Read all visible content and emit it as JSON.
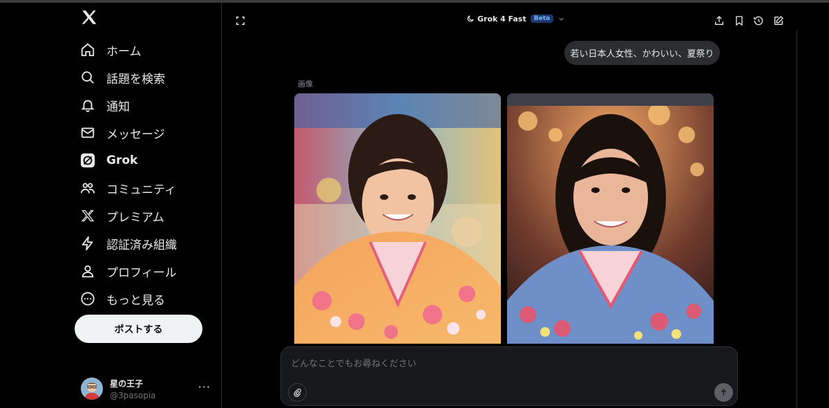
{
  "sidebar": {
    "logo_icon": "x-logo-icon",
    "items": [
      {
        "label": "ホーム",
        "icon": "home-icon"
      },
      {
        "label": "話題を検索",
        "icon": "search-icon"
      },
      {
        "label": "通知",
        "icon": "bell-icon"
      },
      {
        "label": "メッセージ",
        "icon": "mail-icon"
      },
      {
        "label": "Grok",
        "icon": "grok-icon",
        "active": true
      },
      {
        "label": "コミュニティ",
        "icon": "community-icon"
      },
      {
        "label": "プレミアム",
        "icon": "x-premium-icon"
      },
      {
        "label": "認証済み組織",
        "icon": "lightning-icon"
      },
      {
        "label": "プロフィール",
        "icon": "person-icon"
      },
      {
        "label": "もっと見る",
        "icon": "more-circle-icon"
      }
    ],
    "post_button": "ポストする",
    "account": {
      "name": "星の王子",
      "handle": "@3pasopia"
    }
  },
  "header": {
    "model_name": "Grok 4 Fast",
    "badge": "Beta"
  },
  "chat": {
    "user_message": "若い日本人女性、かわいい、夏祭り",
    "images_label": "画像"
  },
  "composer": {
    "placeholder": "どんなことでもお尋ねください"
  },
  "colors": {
    "background": "#000000",
    "text": "#e7e9ea",
    "muted": "#71767b",
    "badge_bg": "#1b3a6b",
    "badge_text": "#7db4ff"
  }
}
